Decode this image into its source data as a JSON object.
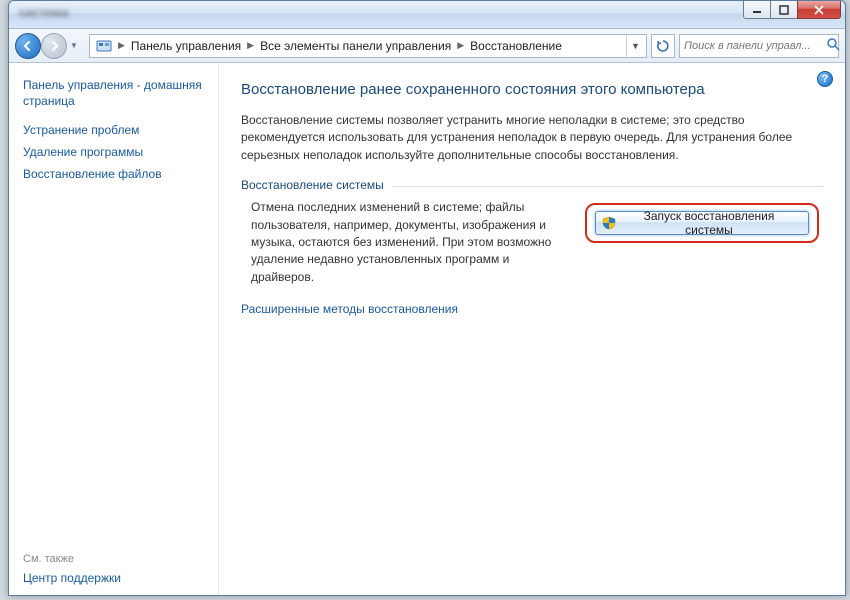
{
  "titlebar": {
    "blurred_text": "система"
  },
  "breadcrumb": {
    "items": [
      "Панель управления",
      "Все элементы панели управления",
      "Восстановление"
    ]
  },
  "search": {
    "placeholder": "Поиск в панели управл..."
  },
  "sidebar": {
    "home_label": "Панель управления - домашняя страница",
    "links": [
      "Устранение проблем",
      "Удаление программы",
      "Восстановление файлов"
    ],
    "see_also_label": "См. также",
    "see_also_link": "Центр поддержки"
  },
  "main": {
    "title": "Восстановление ранее сохраненного состояния этого компьютера",
    "description": "Восстановление системы позволяет устранить многие неполадки в системе; это средство рекомендуется использовать для устранения неполадок в первую очередь. Для устранения более серьезных неполадок используйте дополнительные способы восстановления.",
    "group_label": "Восстановление системы",
    "group_text": "Отмена последних изменений в системе; файлы пользователя, например, документы, изображения и музыка, остаются без изменений. При этом возможно удаление недавно установленных программ и драйверов.",
    "action_button": "Запуск восстановления системы",
    "advanced_link": "Расширенные методы восстановления"
  }
}
